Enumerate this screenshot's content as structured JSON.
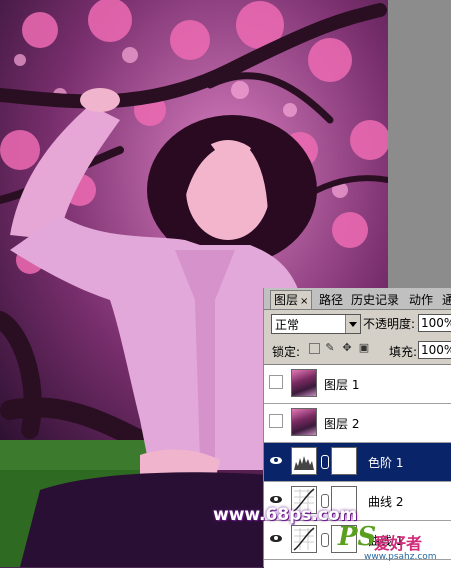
{
  "panel": {
    "tabs": [
      "图层",
      "路径",
      "历史记录",
      "动作",
      "通"
    ],
    "tab_close": "×",
    "blend_mode": "正常",
    "opacity_label": "不透明度:",
    "opacity_value": "100%",
    "lock_label": "锁定:",
    "fill_label": "填充:",
    "fill_value": "100%",
    "layers": [
      {
        "name": "图层 1",
        "visible": false,
        "type": "pixel"
      },
      {
        "name": "图层 2",
        "visible": false,
        "type": "pixel"
      },
      {
        "name": "色阶 1",
        "visible": true,
        "type": "adjustment",
        "selected": true
      },
      {
        "name": "曲线 2",
        "visible": true,
        "type": "adjustment"
      },
      {
        "name": "曲线 1",
        "visible": true,
        "type": "adjustment"
      }
    ]
  },
  "watermark": "www.68ps.com",
  "logo": {
    "ps": "PS",
    "cn": "爱好者",
    "url": "www.psahz.com"
  },
  "colors": {
    "accent": "#0a246a",
    "panel_bg": "#d4d0c8",
    "blossom": "#e35aa6"
  }
}
